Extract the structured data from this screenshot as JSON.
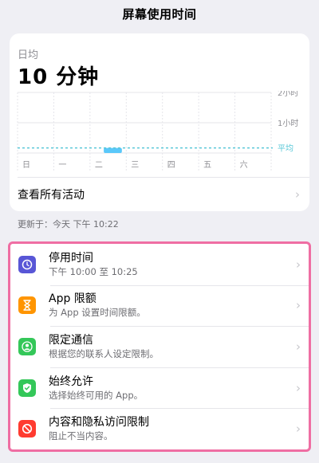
{
  "nav": {
    "title": "屏幕使用时间"
  },
  "summary": {
    "avg_label": "日均",
    "avg_value": "10 分钟",
    "chart": {
      "gridline_labels": [
        "2小时",
        "1小时"
      ],
      "avg_label": "平均",
      "days": [
        "日",
        "一",
        "二",
        "三",
        "四",
        "五",
        "六"
      ],
      "usage_minutes": [
        0,
        0,
        10,
        0,
        0,
        0,
        0
      ],
      "average_minutes": 10,
      "avg_color": "#5ac8d8",
      "bar_color": "#5ac8fa"
    },
    "see_all": "查看所有活动"
  },
  "updated": "更新于：今天 下午 10:22",
  "settings": [
    {
      "title": "停用时间",
      "subtitle": "下午 10:00 至 10:25",
      "icon": "moon-clock-icon",
      "color": "#5856d6"
    },
    {
      "title": "App 限额",
      "subtitle": "为 App 设置时间限额。",
      "icon": "hourglass-icon",
      "color": "#ff9500"
    },
    {
      "title": "限定通信",
      "subtitle": "根据您的联系人设定限制。",
      "icon": "contact-icon",
      "color": "#34c759"
    },
    {
      "title": "始终允许",
      "subtitle": "选择始终可用的 App。",
      "icon": "checkmark-shield-icon",
      "color": "#34c759"
    },
    {
      "title": "内容和隐私访问限制",
      "subtitle": "阻止不当内容。",
      "icon": "restriction-icon",
      "color": "#ff3b30"
    }
  ]
}
